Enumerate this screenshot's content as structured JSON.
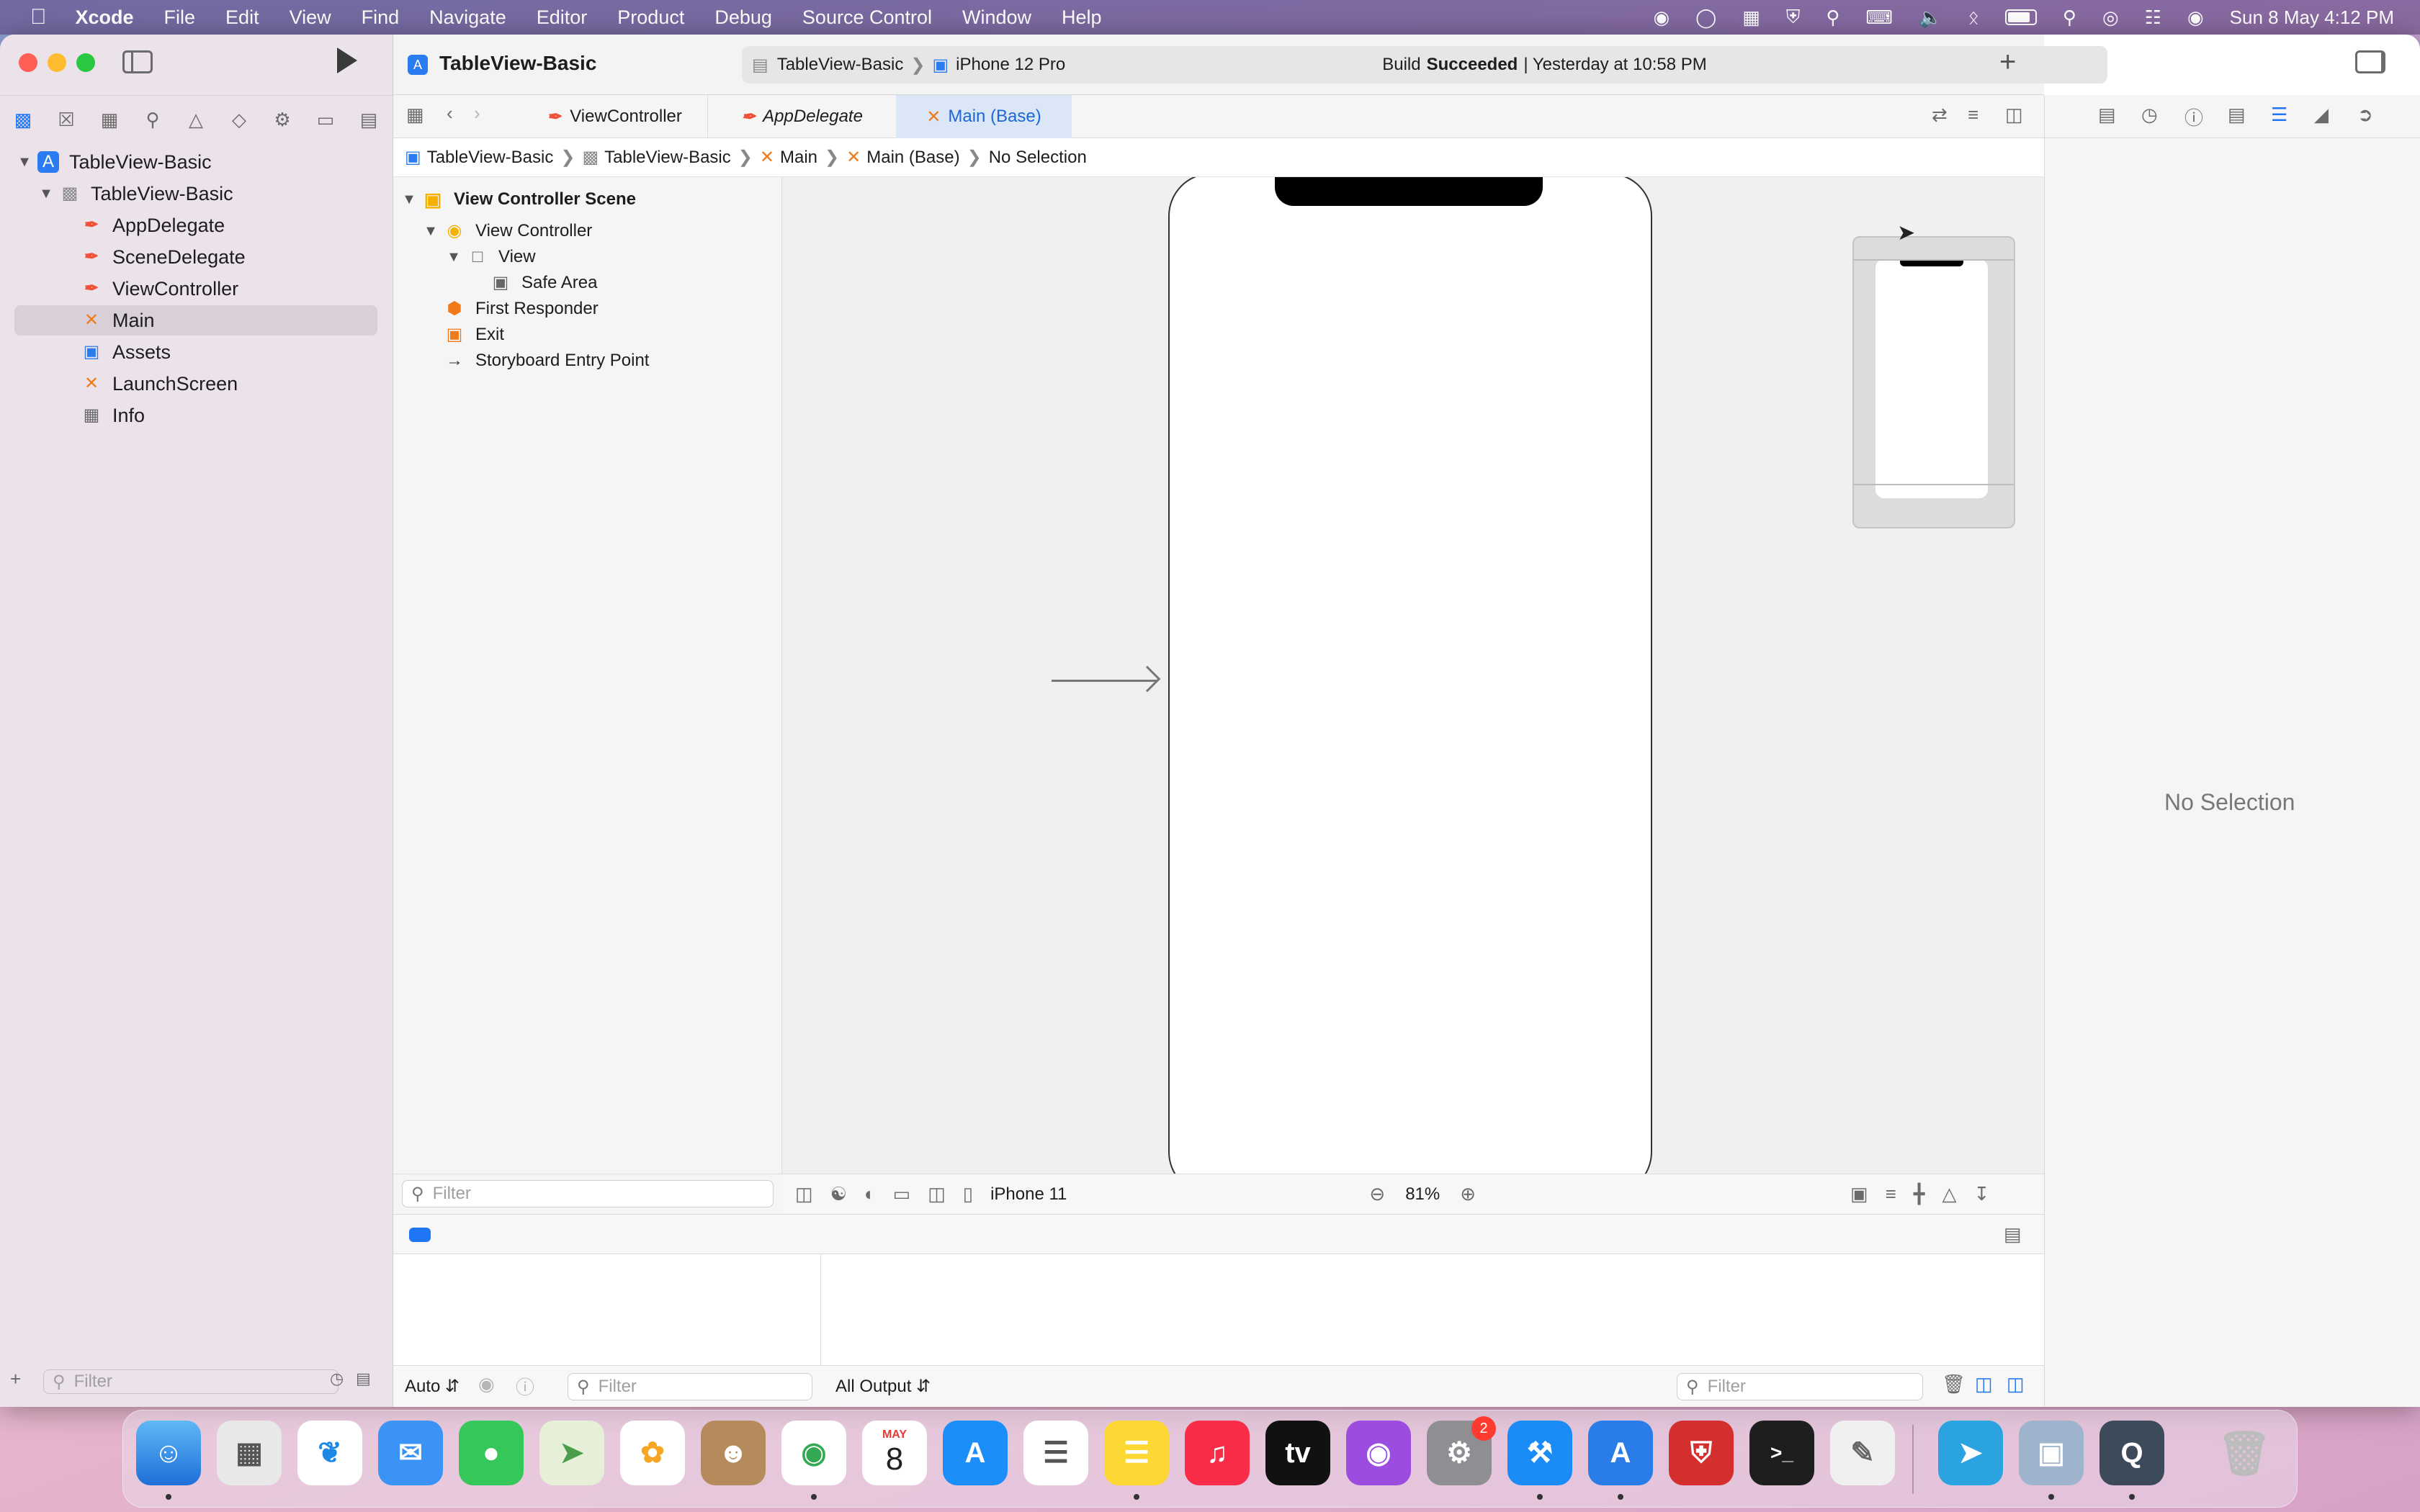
{
  "menubar": {
    "app": "Xcode",
    "items": [
      "File",
      "Edit",
      "View",
      "Find",
      "Navigate",
      "Editor",
      "Product",
      "Debug",
      "Source Control",
      "Window",
      "Help"
    ],
    "datetime": "Sun 8 May  4:12 PM"
  },
  "toolbar": {
    "project": "TableView-Basic",
    "scheme": "TableView-Basic",
    "device": "iPhone 12 Pro",
    "build_status": "Build",
    "build_result": "Succeeded",
    "build_time": "| Yesterday at 10:58 PM"
  },
  "tabs": [
    {
      "label": "ViewController"
    },
    {
      "label": "AppDelegate"
    },
    {
      "label": "Main (Base)"
    }
  ],
  "jumpbar": [
    "TableView-Basic",
    "TableView-Basic",
    "Main",
    "Main (Base)",
    "No Selection"
  ],
  "navigator": {
    "project": "TableView-Basic",
    "group": "TableView-Basic",
    "files": [
      "AppDelegate",
      "SceneDelegate",
      "ViewController",
      "Main",
      "Assets",
      "LaunchScreen",
      "Info"
    ],
    "filter_placeholder": "Filter"
  },
  "outline": {
    "scene": "View Controller Scene",
    "controller": "View Controller",
    "view": "View",
    "safe_area": "Safe Area",
    "responder": "First Responder",
    "exit": "Exit",
    "entry": "Storyboard Entry Point",
    "filter_placeholder": "Filter"
  },
  "canvas": {
    "device": "iPhone 11",
    "zoom": "81%"
  },
  "inspector": {
    "empty": "No Selection"
  },
  "debug": {
    "auto": "Auto",
    "filter": "Filter",
    "output": "All Output",
    "filter2": "Filter"
  },
  "dock": {
    "calendar_month": "MAY",
    "calendar_day": "8",
    "settings_badge": "2"
  }
}
